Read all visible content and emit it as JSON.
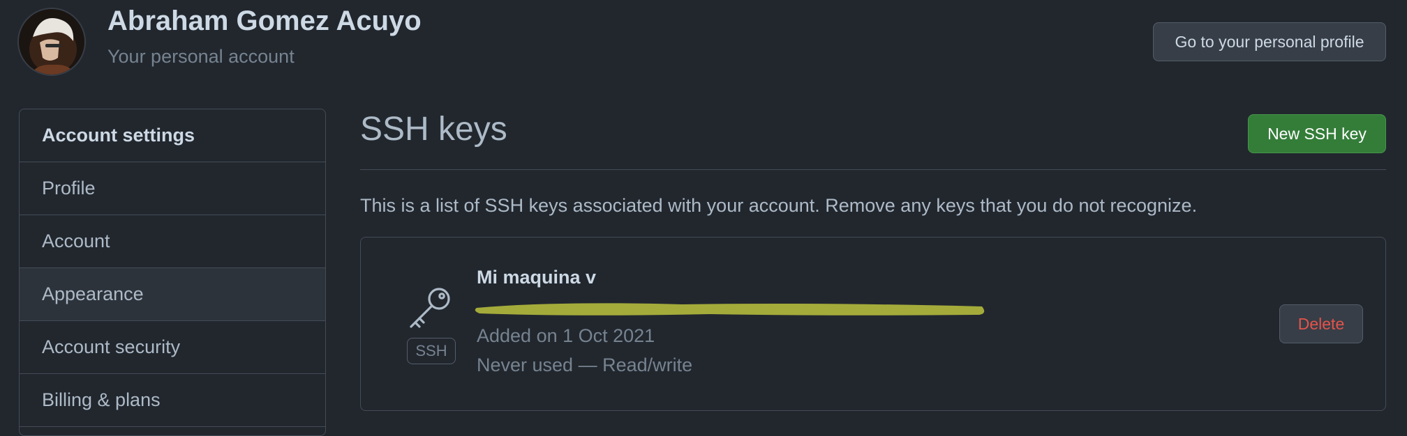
{
  "header": {
    "user_name": "Abraham Gomez Acuyo",
    "subtitle": "Your personal account",
    "profile_button_label": "Go to your personal profile"
  },
  "sidebar": {
    "heading": "Account settings",
    "items": [
      {
        "label": "Profile",
        "selected": false
      },
      {
        "label": "Account",
        "selected": false
      },
      {
        "label": "Appearance",
        "selected": true
      },
      {
        "label": "Account security",
        "selected": false
      },
      {
        "label": "Billing & plans",
        "selected": false
      }
    ]
  },
  "main": {
    "title": "SSH keys",
    "new_key_button_label": "New SSH key",
    "description": "This is a list of SSH keys associated with your account. Remove any keys that you do not recognize.",
    "keys": [
      {
        "title": "Mi maquina v",
        "badge": "SSH",
        "icon": "key-icon",
        "added": "Added on 1 Oct 2021",
        "usage": "Never used — Read/write",
        "delete_label": "Delete"
      }
    ]
  },
  "colors": {
    "background": "#22272e",
    "primary_button": "#347d39",
    "danger_text": "#e5534b",
    "redaction": "#a4ab3a"
  }
}
